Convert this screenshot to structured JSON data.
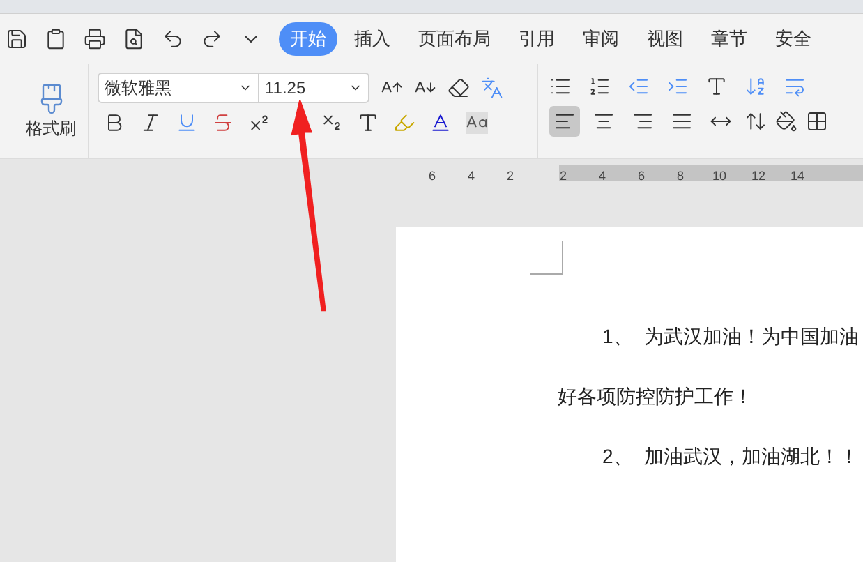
{
  "menu_tabs": [
    {
      "label": "开始",
      "selected": true
    },
    {
      "label": "插入",
      "selected": false
    },
    {
      "label": "页面布局",
      "selected": false
    },
    {
      "label": "引用",
      "selected": false
    },
    {
      "label": "审阅",
      "selected": false
    },
    {
      "label": "视图",
      "selected": false
    },
    {
      "label": "章节",
      "selected": false
    },
    {
      "label": "安全",
      "selected": false
    }
  ],
  "format_painter": {
    "label": "格式刷"
  },
  "font": {
    "name": "微软雅黑",
    "size": "11.25"
  },
  "alignments": [
    {
      "kind": "left",
      "selected": true
    },
    {
      "kind": "center",
      "selected": false
    },
    {
      "kind": "right",
      "selected": false
    },
    {
      "kind": "justify",
      "selected": false
    },
    {
      "kind": "distributed",
      "selected": false
    }
  ],
  "ruler": {
    "ticks": [
      "6",
      "4",
      "2",
      "2",
      "4",
      "6",
      "8",
      "10",
      "12",
      "14"
    ]
  },
  "document": {
    "paragraphs": [
      {
        "number": "1、",
        "text": "为武汉加油！为中国加油"
      },
      {
        "text": "好各项防控防护工作！"
      },
      {
        "number": "2、",
        "text": "加油武汉，加油湖北！！"
      }
    ]
  }
}
